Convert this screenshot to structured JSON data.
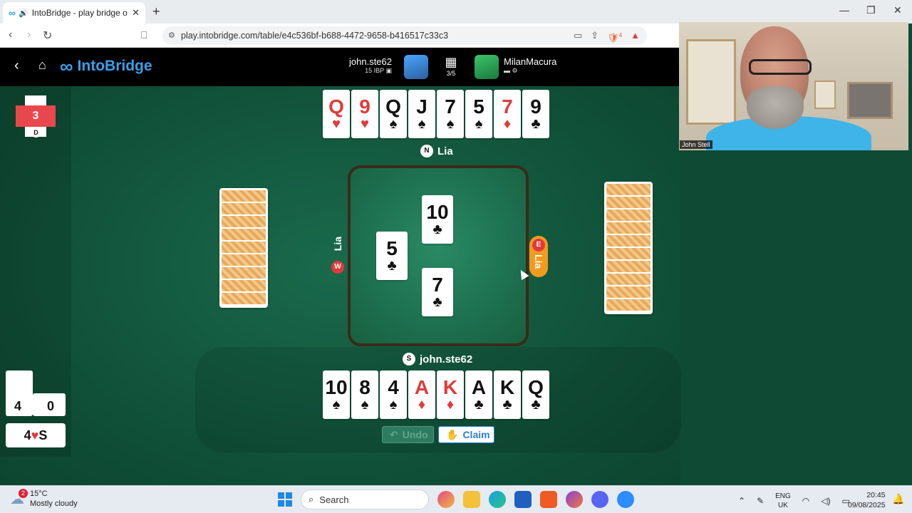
{
  "browser": {
    "tab_title": "IntoBridge - play bridge onlin",
    "url": "play.intobridge.com/table/e4c536bf-b688-4472-9658-b416517c33c3",
    "extension_badge": "4"
  },
  "header": {
    "brand": "IntoBridge",
    "player1": {
      "name": "john.ste62",
      "ibp": "15 IBP"
    },
    "player2": {
      "name": "MilanMacura"
    },
    "board_count": "3/5"
  },
  "scoreboard": {
    "board_number": "3",
    "dealer": "D",
    "tricks_ns": "4",
    "tricks_ew": "0",
    "contract_level": "4",
    "contract_suit": "♥",
    "contract_declarer": "S"
  },
  "north": {
    "label": "Lia",
    "seat": "N",
    "cards": [
      {
        "rank": "Q",
        "suit": "♥",
        "red": true
      },
      {
        "rank": "9",
        "suit": "♥",
        "red": true
      },
      {
        "rank": "Q",
        "suit": "♠",
        "red": false
      },
      {
        "rank": "J",
        "suit": "♠",
        "red": false
      },
      {
        "rank": "7",
        "suit": "♠",
        "red": false
      },
      {
        "rank": "5",
        "suit": "♠",
        "red": false
      },
      {
        "rank": "7",
        "suit": "♦",
        "red": true
      },
      {
        "rank": "9",
        "suit": "♣",
        "red": false
      }
    ]
  },
  "south": {
    "label": "john.ste62",
    "seat": "S",
    "cards": [
      {
        "rank": "10",
        "suit": "♠",
        "red": false
      },
      {
        "rank": "8",
        "suit": "♠",
        "red": false
      },
      {
        "rank": "4",
        "suit": "♠",
        "red": false
      },
      {
        "rank": "A",
        "suit": "♦",
        "red": true
      },
      {
        "rank": "K",
        "suit": "♦",
        "red": true
      },
      {
        "rank": "A",
        "suit": "♣",
        "red": false
      },
      {
        "rank": "K",
        "suit": "♣",
        "red": false
      },
      {
        "rank": "Q",
        "suit": "♣",
        "red": false
      }
    ]
  },
  "west": {
    "label": "Lia",
    "seat": "W"
  },
  "east": {
    "label": "Lia",
    "seat": "E"
  },
  "trick": {
    "north_card": {
      "rank": "10",
      "suit": "♣"
    },
    "west_card": {
      "rank": "5",
      "suit": "♣"
    },
    "south_card": {
      "rank": "7",
      "suit": "♣"
    }
  },
  "controls": {
    "undo": "Undo",
    "claim": "Claim"
  },
  "video": {
    "name": "John Stell"
  },
  "taskbar": {
    "weather_temp": "15°C",
    "weather_desc": "Mostly cloudy",
    "weather_badge": "2",
    "search": "Search",
    "lang1": "ENG",
    "lang2": "UK",
    "time": "20:45",
    "date": "09/08/2025"
  }
}
